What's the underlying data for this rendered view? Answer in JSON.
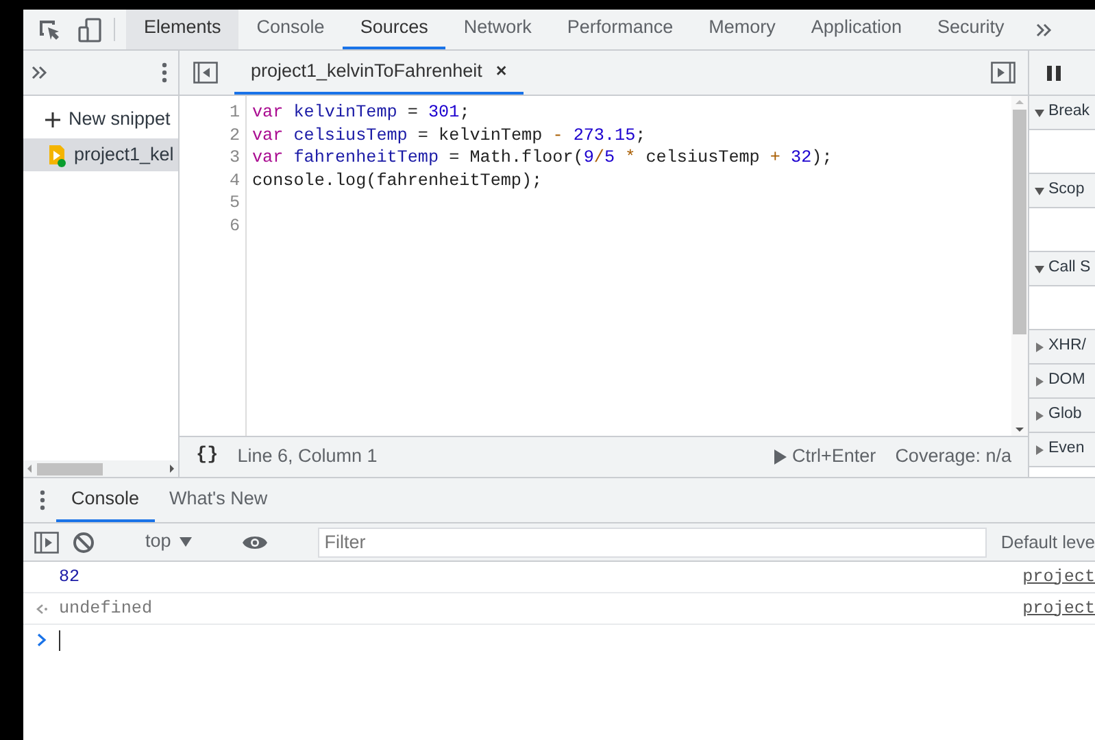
{
  "main_tabs": [
    {
      "label": "Elements",
      "selected": false,
      "hovered": true
    },
    {
      "label": "Console",
      "selected": false,
      "hovered": false
    },
    {
      "label": "Sources",
      "selected": true,
      "hovered": false
    },
    {
      "label": "Network",
      "selected": false,
      "hovered": false
    },
    {
      "label": "Performance",
      "selected": false,
      "hovered": false
    },
    {
      "label": "Memory",
      "selected": false,
      "hovered": false
    },
    {
      "label": "Application",
      "selected": false,
      "hovered": false
    },
    {
      "label": "Security",
      "selected": false,
      "hovered": false
    }
  ],
  "navigator": {
    "new_snippet": "New snippet",
    "files": [
      {
        "name": "project1_kel",
        "selected": true
      }
    ]
  },
  "editor": {
    "tabs": [
      {
        "label": "project1_kelvinToFahrenheit",
        "selected": true,
        "close": "×"
      }
    ],
    "lines": [
      {
        "number": "1",
        "tokens": [
          {
            "kind": "keyword",
            "text": "var "
          },
          {
            "kind": "def",
            "text": "kelvinTemp"
          },
          {
            "kind": "plain",
            "text": " = "
          },
          {
            "kind": "number",
            "text": "301"
          },
          {
            "kind": "plain",
            "text": ";"
          }
        ]
      },
      {
        "number": "2",
        "tokens": [
          {
            "kind": "keyword",
            "text": "var "
          },
          {
            "kind": "def",
            "text": "celsiusTemp"
          },
          {
            "kind": "plain",
            "text": " = kelvinTemp "
          },
          {
            "kind": "operator",
            "text": "- "
          },
          {
            "kind": "number",
            "text": "273.15"
          },
          {
            "kind": "plain",
            "text": ";"
          }
        ]
      },
      {
        "number": "3",
        "tokens": [
          {
            "kind": "keyword",
            "text": "var "
          },
          {
            "kind": "def",
            "text": "fahrenheitTemp"
          },
          {
            "kind": "plain",
            "text": " = Math.floor("
          },
          {
            "kind": "number",
            "text": "9"
          },
          {
            "kind": "operator",
            "text": "/"
          },
          {
            "kind": "number",
            "text": "5"
          },
          {
            "kind": "operator",
            "text": " *"
          },
          {
            "kind": "plain",
            "text": " celsiusTemp "
          },
          {
            "kind": "operator",
            "text": "+ "
          },
          {
            "kind": "number",
            "text": "32"
          },
          {
            "kind": "plain",
            "text": ");"
          }
        ]
      },
      {
        "number": "4",
        "tokens": [
          {
            "kind": "plain",
            "text": "console.log(fahrenheitTemp);"
          }
        ]
      },
      {
        "number": "5"
      },
      {
        "number": "6"
      }
    ],
    "status": {
      "format": "{}",
      "position": "Line 6, Column 1",
      "run": "Ctrl+Enter",
      "coverage": "Coverage: n/a"
    }
  },
  "debugger": {
    "sections": [
      {
        "label": "Break",
        "expanded": true
      },
      {
        "label": "Scop",
        "expanded": true
      },
      {
        "label": "Call S",
        "expanded": true
      },
      {
        "label": "XHR/",
        "expanded": false
      },
      {
        "label": "DOM",
        "expanded": false
      },
      {
        "label": "Glob",
        "expanded": false
      },
      {
        "label": "Even",
        "expanded": false
      }
    ]
  },
  "drawer": {
    "tabs": [
      {
        "label": "Console",
        "selected": true
      },
      {
        "label": "What's New",
        "selected": false
      }
    ],
    "context": "top",
    "filter": {
      "placeholder": "Filter"
    },
    "levels": "Default leve",
    "messages": [
      {
        "kind": "log",
        "text": "82",
        "source": "project"
      },
      {
        "kind": "result",
        "text": "undefined",
        "source": "project"
      }
    ]
  }
}
